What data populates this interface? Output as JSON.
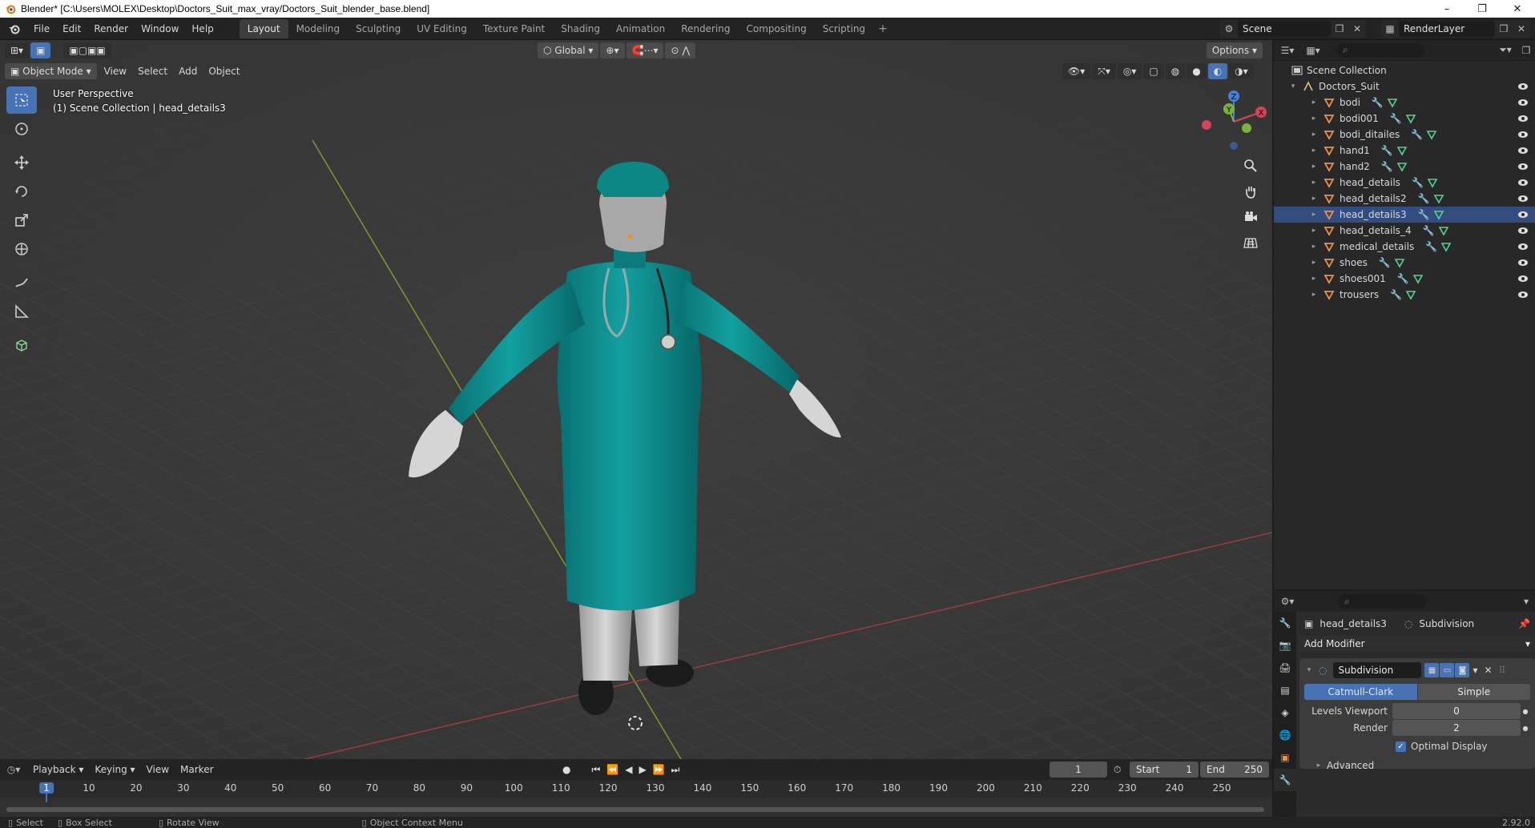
{
  "window": {
    "title": "Blender* [C:\\Users\\MOLEX\\Desktop\\Doctors_Suit_max_vray/Doctors_Suit_blender_base.blend]",
    "minimize": "–",
    "restore": "❐",
    "close": "✕"
  },
  "menus": [
    "File",
    "Edit",
    "Render",
    "Window",
    "Help"
  ],
  "workspaces": [
    "Layout",
    "Modeling",
    "Sculpting",
    "UV Editing",
    "Texture Paint",
    "Shading",
    "Animation",
    "Rendering",
    "Compositing",
    "Scripting"
  ],
  "active_workspace": "Layout",
  "scene_name": "Scene",
  "render_layer": "RenderLayer",
  "viewport": {
    "mode": "Object Mode",
    "menus": [
      "View",
      "Select",
      "Add",
      "Object"
    ],
    "transform_orientation": "Global",
    "options_label": "Options",
    "perspective_label": "User Perspective",
    "collection_label": "(1) Scene Collection | head_details3"
  },
  "gizmo": {
    "z": "Z",
    "y": "Y",
    "x": "X"
  },
  "outliner": {
    "root": "Scene Collection",
    "collection": "Doctors_Suit",
    "objects": [
      "bodi",
      "bodi001",
      "bodi_ditailes",
      "hand1",
      "hand2",
      "head_details",
      "head_details2",
      "head_details3",
      "head_details_4",
      "medical_details",
      "shoes",
      "shoes001",
      "trousers"
    ],
    "selected": "head_details3"
  },
  "properties": {
    "object_name": "head_details3",
    "modifier_crumb": "Subdivision",
    "add_modifier": "Add Modifier",
    "modifier_name": "Subdivision",
    "type_catmull": "Catmull-Clark",
    "type_simple": "Simple",
    "levels_viewport_label": "Levels Viewport",
    "levels_viewport_value": "0",
    "render_label": "Render",
    "render_value": "2",
    "optimal_display": "Optimal Display",
    "advanced": "Advanced"
  },
  "timeline": {
    "menus": [
      "Playback",
      "Keying",
      "View",
      "Marker"
    ],
    "current_frame": "1",
    "start_label": "Start",
    "start_value": "1",
    "end_label": "End",
    "end_value": "250",
    "ticks": [
      "1",
      "10",
      "20",
      "30",
      "40",
      "50",
      "60",
      "70",
      "80",
      "90",
      "100",
      "110",
      "120",
      "130",
      "140",
      "150",
      "160",
      "170",
      "180",
      "190",
      "200",
      "210",
      "220",
      "230",
      "240",
      "250"
    ]
  },
  "statusbar": {
    "select": "Select",
    "box_select": "Box Select",
    "rotate_view": "Rotate View",
    "context_menu": "Object Context Menu",
    "version": "2.92.0"
  },
  "colors": {
    "accent": "#4772b3",
    "mesh_icon": "#e8944a",
    "modifier_icon": "#7aa7d8",
    "mesh_data": "#5bd08f",
    "suit": "#0e8a8a"
  }
}
